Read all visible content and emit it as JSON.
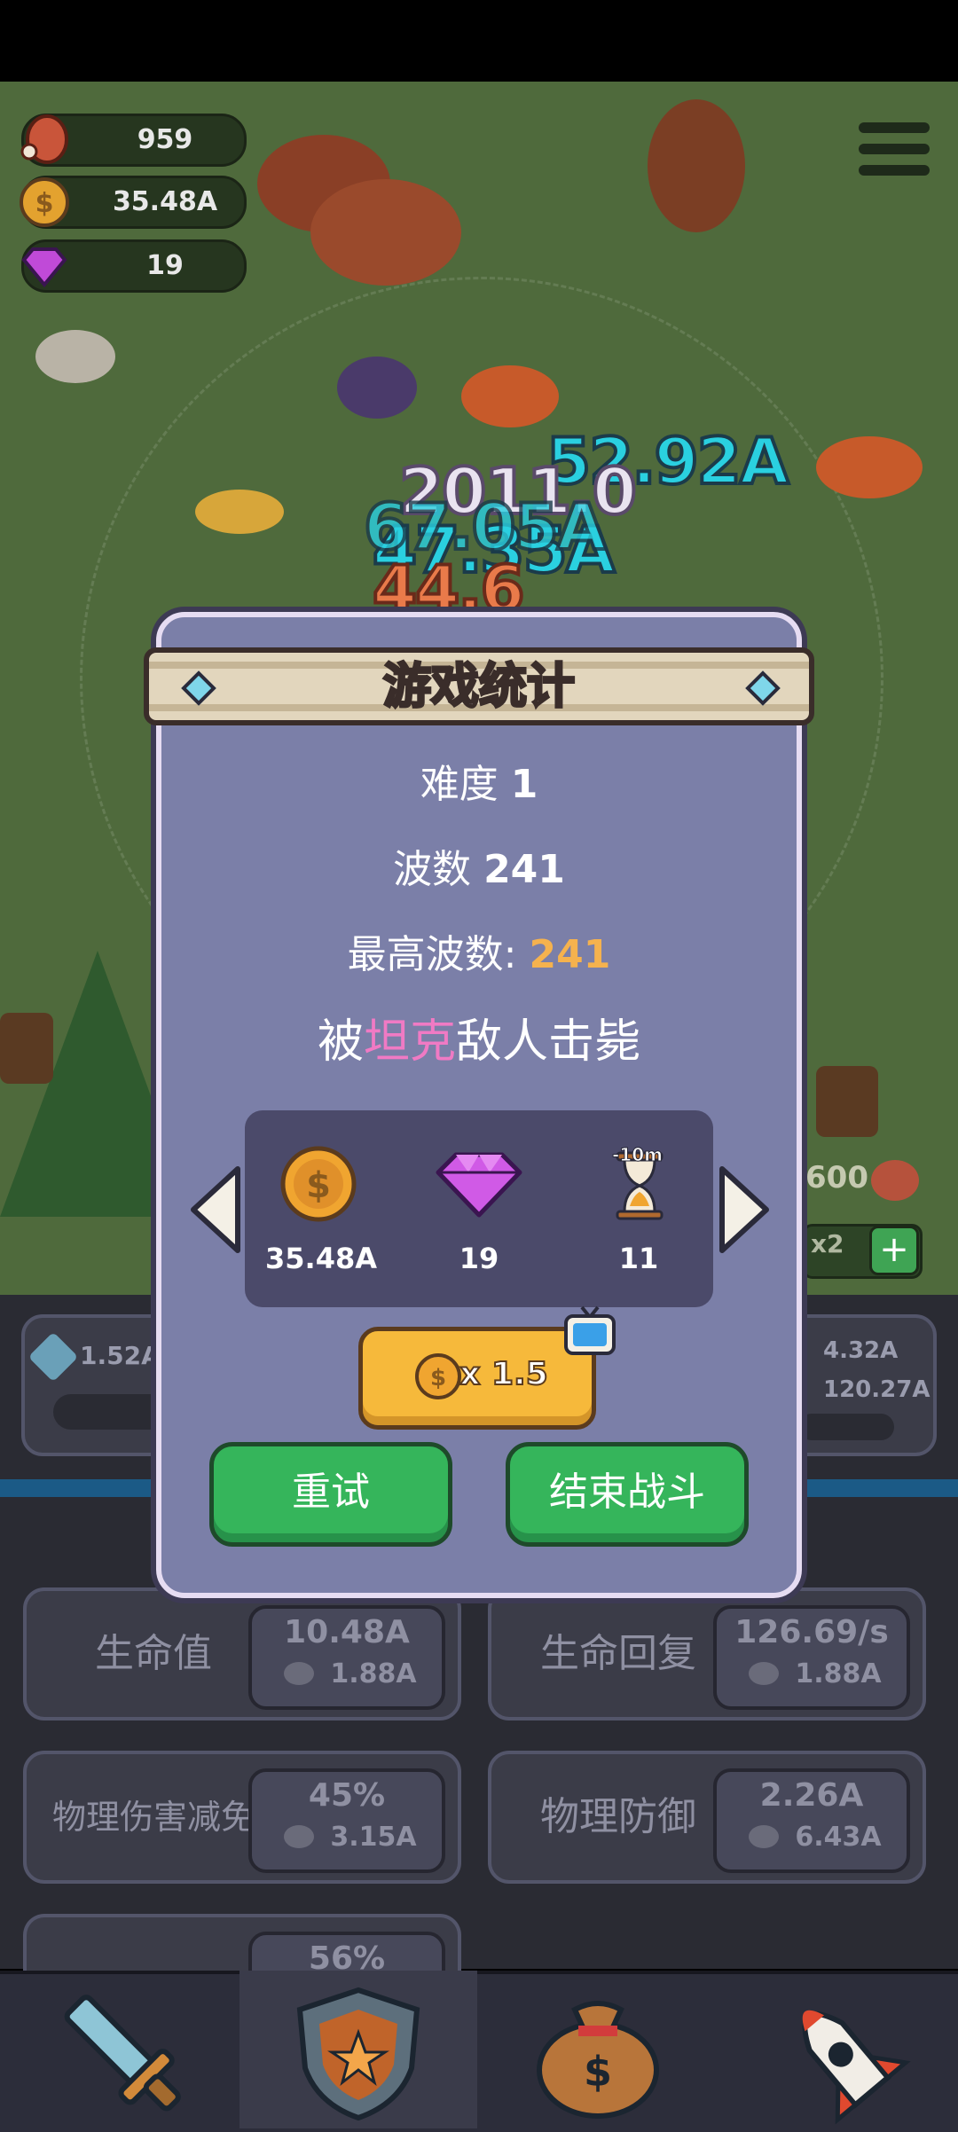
{
  "resources": {
    "meat": "959",
    "coins": "35.48A",
    "gems": "19"
  },
  "floating_numbers": [
    "52.92A",
    "47.35A",
    "2011.0",
    "67.05A",
    "44.6"
  ],
  "side_values": {
    "left_attack": "1.52A",
    "right_attack": "4.32A",
    "right_health": "120.27A",
    "wave_counter": "600",
    "speed": "x2"
  },
  "stats": [
    {
      "name": "生命值",
      "value": "10.48A",
      "cost": "1.88A"
    },
    {
      "name": "生命回复",
      "value": "126.69/s",
      "cost": "1.88A"
    },
    {
      "name": "物理伤害减免",
      "value": "45%",
      "cost": "3.15A"
    },
    {
      "name": "物理防御",
      "value": "2.26A",
      "cost": "6.43A"
    },
    {
      "name": "...",
      "value": "56%",
      "cost": ""
    }
  ],
  "modal": {
    "title": "游戏统计",
    "difficulty_label": "难度",
    "difficulty_value": "1",
    "wave_label": "波数",
    "wave_value": "241",
    "best_wave_label": "最高波数:",
    "best_wave_value": "241",
    "killed_prefix": "被",
    "killed_enemy": "坦克",
    "killed_suffix": "敌人击毙",
    "rewards": [
      {
        "icon": "coin-icon",
        "value": "35.48A"
      },
      {
        "icon": "gem-icon",
        "value": "19"
      },
      {
        "icon": "hourglass-icon",
        "value": "11",
        "badge": "-10m"
      }
    ],
    "multiplier_label": "x 1.5",
    "retry_label": "重试",
    "end_battle_label": "结束战斗"
  },
  "colors": {
    "accent_orange": "#f5b24e",
    "accent_pink": "#f07ac4",
    "button_green": "#35b55b",
    "modal_bg": "#7b7fa8"
  }
}
